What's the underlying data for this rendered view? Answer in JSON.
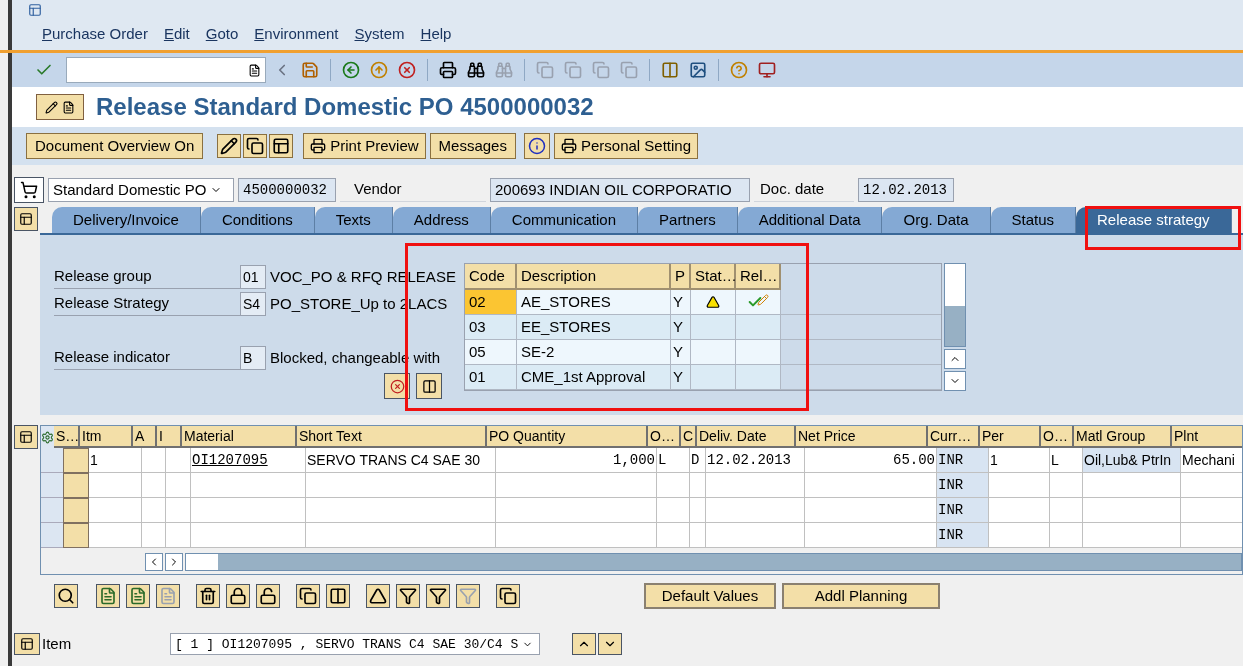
{
  "menu": [
    {
      "label": "Purchase Order"
    },
    {
      "label": "Edit"
    },
    {
      "label": "Goto"
    },
    {
      "label": "Environment"
    },
    {
      "label": "System"
    },
    {
      "label": "Help"
    }
  ],
  "title": "Release Standard Domestic PO 4500000032",
  "app_toolbar": [
    {
      "kind": "text",
      "label": "Document Overview On"
    },
    {
      "kind": "icons"
    },
    {
      "kind": "icon_text",
      "label": "Print Preview"
    },
    {
      "kind": "text",
      "label": "Messages"
    },
    {
      "kind": "info"
    },
    {
      "kind": "icon_text",
      "label": "Personal Setting"
    }
  ],
  "header": {
    "doc_type": "Standard Domestic PO",
    "doc_number": "4500000032",
    "vendor_label": "Vendor",
    "vendor": "200693 INDIAN OIL CORPORATIO",
    "date_label": "Doc. date",
    "date": "12.02.2013"
  },
  "tabs": [
    {
      "label": "Delivery/Invoice",
      "selected": false
    },
    {
      "label": "Conditions",
      "selected": false
    },
    {
      "label": "Texts",
      "selected": false
    },
    {
      "label": "Address",
      "selected": false
    },
    {
      "label": "Communication",
      "selected": false
    },
    {
      "label": "Partners",
      "selected": false
    },
    {
      "label": "Additional Data",
      "selected": false
    },
    {
      "label": "Org. Data",
      "selected": false
    },
    {
      "label": "Status",
      "selected": false
    },
    {
      "label": "Release strategy",
      "selected": true
    }
  ],
  "release_fields": [
    {
      "label": "Release group",
      "code": "01",
      "text": "VOC_PO & RFQ RELEASE"
    },
    {
      "label": "Release Strategy",
      "code": "S4",
      "text": "PO_STORE_Up to 2LACS"
    },
    {
      "label": "Release indicator",
      "code": "B",
      "text": "Blocked, changeable with"
    }
  ],
  "release_table": {
    "columns": [
      "Code",
      "Description",
      "P",
      "Stat…",
      "Rel…"
    ],
    "rows": [
      {
        "code": "02",
        "description": "AE_STORES",
        "p": "Y",
        "status_warning": true,
        "released": true,
        "selected": true
      },
      {
        "code": "03",
        "description": "EE_STORES",
        "p": "Y",
        "status_warning": false,
        "released": false,
        "selected": false
      },
      {
        "code": "05",
        "description": "SE-2",
        "p": "Y",
        "status_warning": false,
        "released": false,
        "selected": false
      },
      {
        "code": "01",
        "description": "CME_1st Approval",
        "p": "Y",
        "status_warning": false,
        "released": false,
        "selected": false
      }
    ]
  },
  "items": {
    "columns": [
      "S…",
      "Itm",
      "A",
      "I",
      "Material",
      "Short Text",
      "PO Quantity",
      "O…",
      "C",
      "Deliv. Date",
      "Net Price",
      "Curr…",
      "Per",
      "O…",
      "Matl Group",
      "Plnt"
    ],
    "rows": [
      [
        "",
        "1",
        "",
        "",
        "OI1207095",
        "SERVO TRANS C4 SAE 30",
        "1,000",
        "L",
        "D",
        "12.02.2013",
        "65.00",
        "INR",
        "1",
        "L",
        "Oil,Lub& PtrIn",
        "Mechani"
      ],
      [
        "",
        "",
        "",
        "",
        "",
        "",
        "",
        "",
        "",
        "",
        "",
        "INR",
        "",
        "",
        "",
        ""
      ],
      [
        "",
        "",
        "",
        "",
        "",
        "",
        "",
        "",
        "",
        "",
        "",
        "INR",
        "",
        "",
        "",
        ""
      ],
      [
        "",
        "",
        "",
        "",
        "",
        "",
        "",
        "",
        "",
        "",
        "",
        "INR",
        "",
        "",
        "",
        ""
      ]
    ]
  },
  "item_buttons": [
    "Default Values",
    "Addl Planning"
  ],
  "item_detail": {
    "label": "Item",
    "value": "[ 1 ] OI1207095 , SERVO TRANS C4 SAE 30/C4 S"
  }
}
